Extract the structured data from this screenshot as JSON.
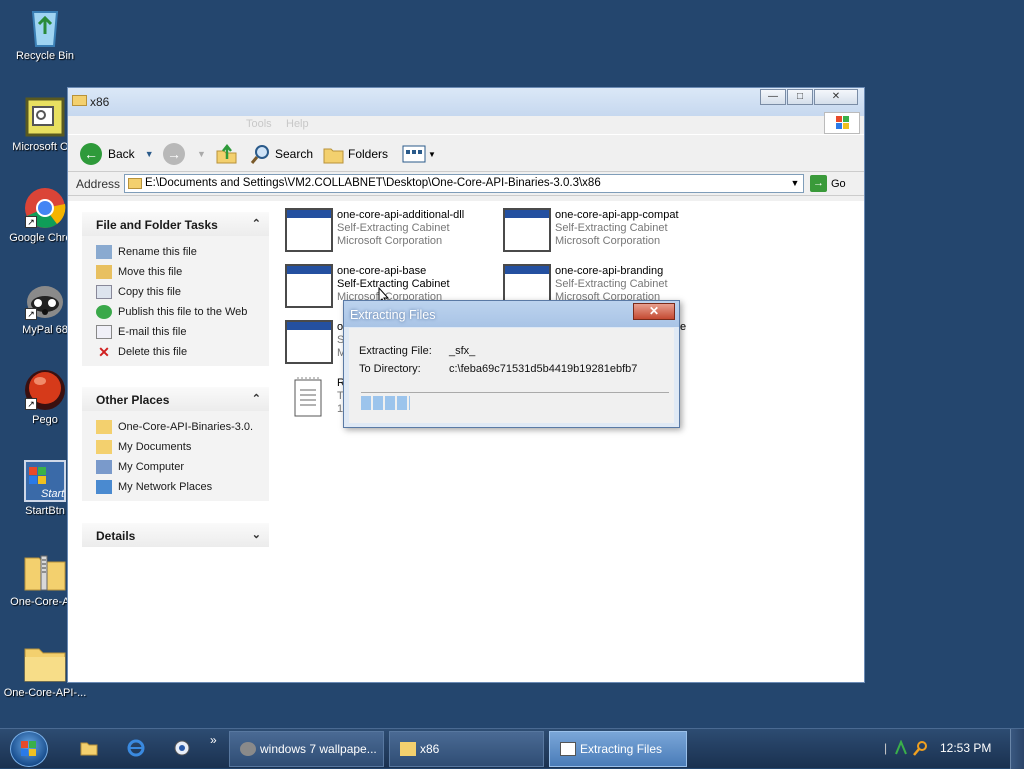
{
  "desktop": {
    "icons": [
      {
        "label": "Recycle Bin"
      },
      {
        "label": "Microsoft Out"
      },
      {
        "label": "Google Chrom"
      },
      {
        "label": "MyPal 68"
      },
      {
        "label": "Pego"
      },
      {
        "label": "StartBtn"
      },
      {
        "label": "One-Core-API"
      },
      {
        "label": "One-Core-API-..."
      }
    ],
    "startbtn_icon_text": "Start"
  },
  "explorer": {
    "title": "x86",
    "menu": [
      "Tools",
      "Help"
    ],
    "toolbar": {
      "back": "Back",
      "search": "Search",
      "folders": "Folders"
    },
    "address": {
      "label": "Address",
      "value": "E:\\Documents and Settings\\VM2.COLLABNET\\Desktop\\One-Core-API-Binaries-3.0.3\\x86",
      "go": "Go"
    },
    "tasks_panel": {
      "title": "File and Folder Tasks",
      "items": [
        "Rename this file",
        "Move this file",
        "Copy this file",
        "Publish this file to the Web",
        "E-mail this file",
        "Delete this file"
      ]
    },
    "places_panel": {
      "title": "Other Places",
      "items": [
        "One-Core-API-Binaries-3.0.",
        "My Documents",
        "My Computer",
        "My Network Places"
      ]
    },
    "details_panel": {
      "title": "Details"
    },
    "files": [
      {
        "name": "one-core-api-additional-dll",
        "type": "Self-Extracting Cabinet",
        "company": "Microsoft Corporation"
      },
      {
        "name": "one-core-api-app-compat",
        "type": "Self-Extracting Cabinet",
        "company": "Microsoft Corporation"
      },
      {
        "name": "one-core-api-base",
        "type": "Self-Extracting Cabinet",
        "company": "Microsoft Corporation"
      },
      {
        "name": "one-core-api-branding",
        "type": "Self-Extracting Cabinet",
        "company": "Microsoft Corporation"
      },
      {
        "name": "o",
        "type": "S",
        "company": "M",
        "trail": "e"
      },
      {
        "name": "R",
        "type": "T",
        "company": "1"
      }
    ]
  },
  "dialog": {
    "title": "Extracting Files",
    "file_label": "Extracting File:",
    "file_value": "_sfx_",
    "dir_label": "To Directory:",
    "dir_value": "c:\\feba69c71531d5b4419b19281ebfb7",
    "progress": 0.16
  },
  "taskbar": {
    "buttons": [
      {
        "label": "windows 7 wallpape..."
      },
      {
        "label": "x86"
      },
      {
        "label": "Extracting Files"
      }
    ],
    "clock": "12:53 PM",
    "overflow": "»"
  },
  "colors": {
    "desktop": "#24466e",
    "accent": "#2450a0"
  }
}
